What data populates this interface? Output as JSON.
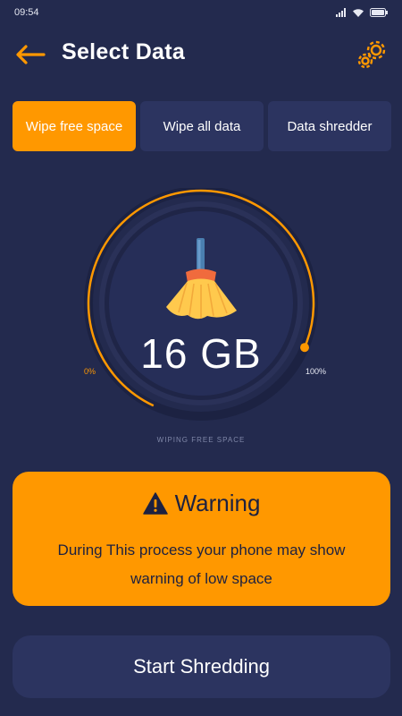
{
  "status_bar": {
    "time": "09:54",
    "icons": [
      "signal-icon",
      "wifi-icon",
      "battery-icon"
    ]
  },
  "header": {
    "title": "Select Data",
    "back_icon": "arrow-left-icon",
    "settings_icon": "gear-icon"
  },
  "tabs": [
    {
      "label": "Wipe free space",
      "active": true
    },
    {
      "label": "Wipe all data",
      "active": false
    },
    {
      "label": "Data shredder",
      "active": false
    }
  ],
  "gauge": {
    "value": "16 GB",
    "min_label": "0%",
    "max_label": "100%",
    "progress": 1.0,
    "caption": "WIPING FREE SPACE",
    "icon": "broom-icon"
  },
  "warning": {
    "icon": "warning-triangle-icon",
    "title": "Warning",
    "message": "During This process your phone may show warning of low space"
  },
  "start_button": {
    "label": "Start Shredding"
  },
  "colors": {
    "background": "#232a4e",
    "surface": "#2c3460",
    "accent": "#ff9800",
    "dark_text": "#1d2140"
  }
}
